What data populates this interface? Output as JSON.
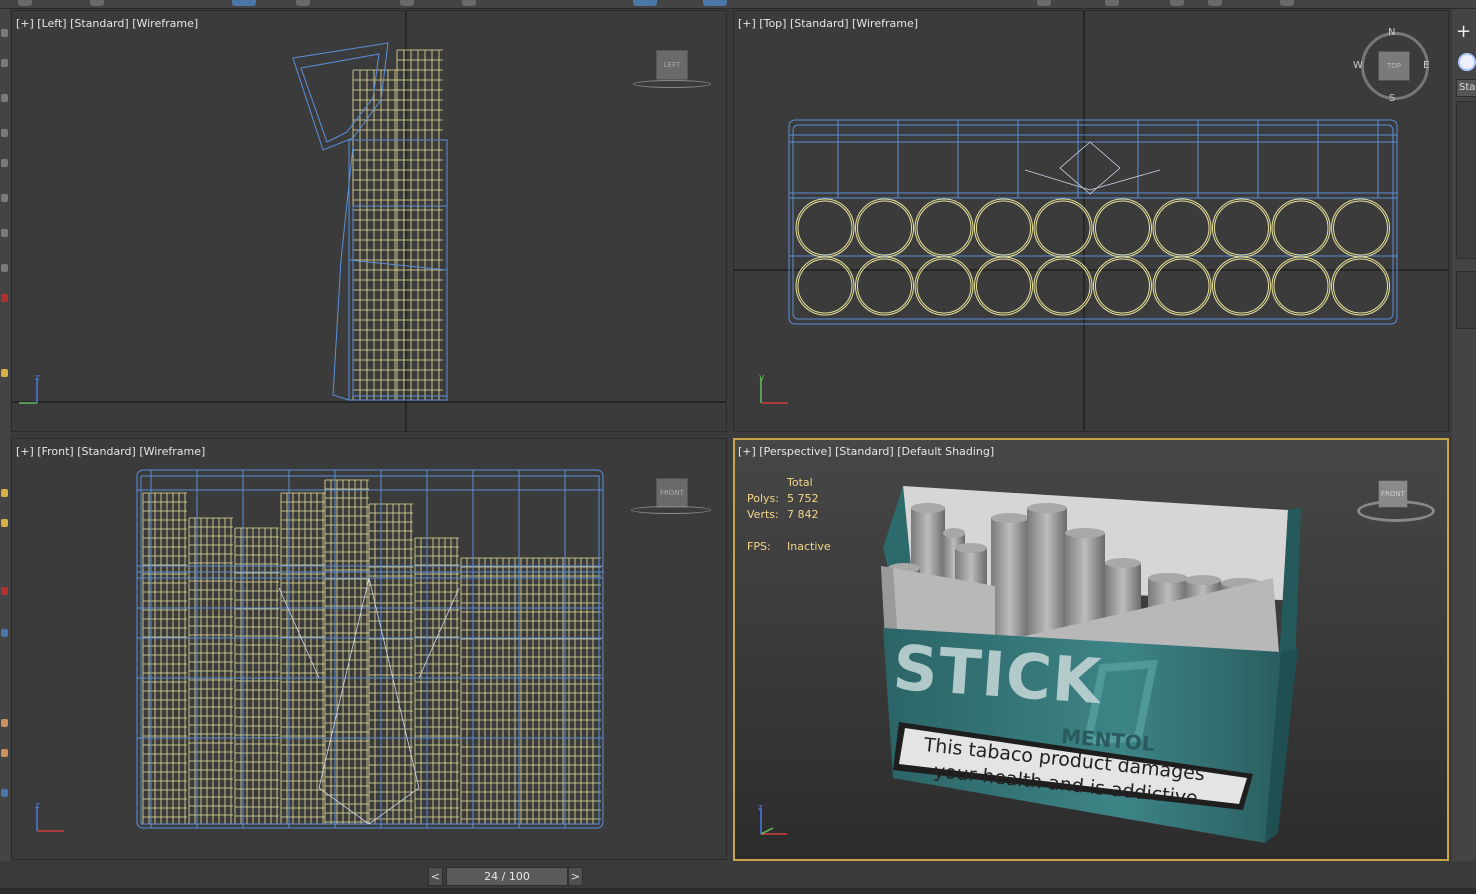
{
  "viewports": {
    "left": {
      "label": "[+] [Left] [Standard] [Wireframe]",
      "cube": "LEFT"
    },
    "top": {
      "label": "[+] [Top] [Standard] [Wireframe]",
      "cube": "TOP",
      "compass": {
        "n": "N",
        "s": "S",
        "e": "E",
        "w": "W"
      }
    },
    "front": {
      "label": "[+] [Front] [Standard] [Wireframe]",
      "cube": "FRONT"
    },
    "perspective": {
      "label": "[+] [Perspective] [Standard] [Default Shading]",
      "cube": "FRONT"
    }
  },
  "stats": {
    "total_label": "Total",
    "polys_label": "Polys:",
    "polys_value": "5 752",
    "verts_label": "Verts:",
    "verts_value": "7 842",
    "fps_label": "FPS:",
    "fps_value": "Inactive"
  },
  "pack": {
    "brand": "STICK",
    "variant": "MENTOL",
    "warning_line1": "This tabaco product damages",
    "warning_line2": "your health and is addictive"
  },
  "right_panel": {
    "dropdown": "Sta"
  },
  "timeline": {
    "frame": "24 / 100",
    "prev": "<",
    "next": ">"
  },
  "colors": {
    "wire_blue": "#5b8fd8",
    "wire_yellow": "#e8e29a",
    "active_border": "#c8a44a",
    "teal": "#2f6e70"
  }
}
